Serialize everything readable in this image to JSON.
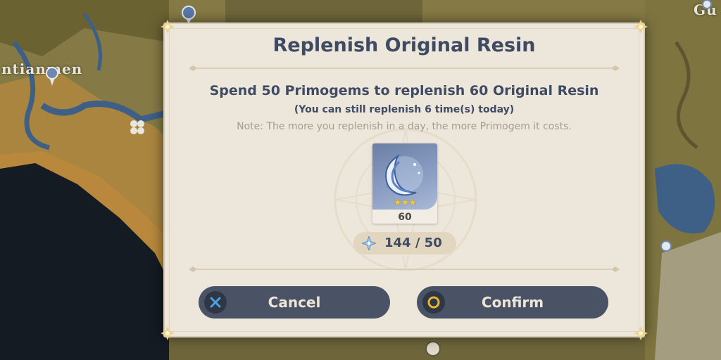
{
  "map": {
    "labels": [
      "ntianmen",
      "Gu"
    ],
    "colors": {
      "land": "#857a45",
      "land_dark": "#6b6232",
      "sea": "#141b23",
      "river": "#3e5f86",
      "sand": "#c48b3a"
    },
    "icons": [
      "waypoint-icon",
      "statue-icon",
      "domain-icon",
      "clover-icon"
    ]
  },
  "dialog": {
    "title": "Replenish Original Resin",
    "main_text": "Spend 50 Primogems to replenish 60 Original Resin",
    "sub_text": "(You can still replenish 6 time(s) today)",
    "note_text": "Note: The more you replenish in a day, the more Primogem it costs.",
    "item": {
      "name_icon": "original-resin-icon",
      "rarity_stars": "★★★",
      "count": "60"
    },
    "cost": {
      "icon": "primogem-icon",
      "text": "144 / 50"
    },
    "buttons": {
      "cancel": {
        "label": "Cancel",
        "icon": "cross-icon"
      },
      "confirm": {
        "label": "Confirm",
        "icon": "circle-icon"
      }
    },
    "colors": {
      "background": "#ede6da",
      "title_text": "#3f4b63",
      "note_text": "#a39d92",
      "button_bg": "#4a5366",
      "cancel_icon": "#4aa0e0",
      "confirm_icon": "#e8b52e",
      "star": "#f2c842"
    }
  }
}
